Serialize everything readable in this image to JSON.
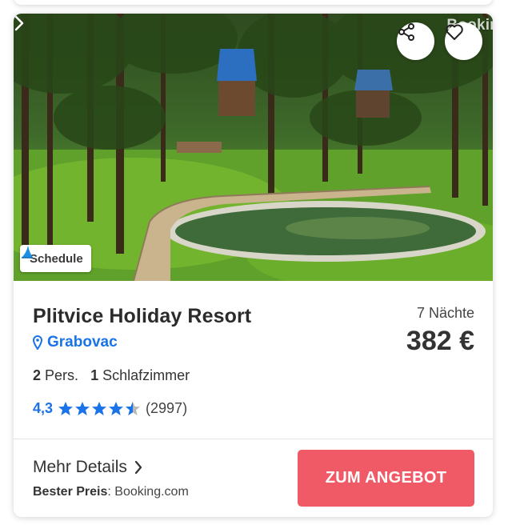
{
  "watermark": "Bookin",
  "badge": {
    "label": "Schedule",
    "icon": "sail-icon"
  },
  "actions": {
    "share_icon": "share-icon",
    "favorite_icon": "heart-icon",
    "next_icon": "chevron-right-icon"
  },
  "listing": {
    "title": "Plitvice Holiday Resort",
    "location": "Grabovac",
    "location_icon": "map-pin-icon",
    "persons_count": "2",
    "persons_label": "Pers.",
    "bedrooms_count": "1",
    "bedrooms_label": "Schlafzimmer",
    "rating": "4,3",
    "rating_stars": 4.5,
    "reviews": "(2997)"
  },
  "pricing": {
    "nights": "7 Nächte",
    "price": "382 €"
  },
  "footer": {
    "more_details": "Mehr Details",
    "best_price_label": "Bester Preis",
    "best_price_source": ": Booking.com",
    "offer_button": "ZUM ANGEBOT"
  },
  "colors": {
    "accent_blue": "#1a73e8",
    "cta": "#f05a66",
    "star": "#1a73e8"
  }
}
